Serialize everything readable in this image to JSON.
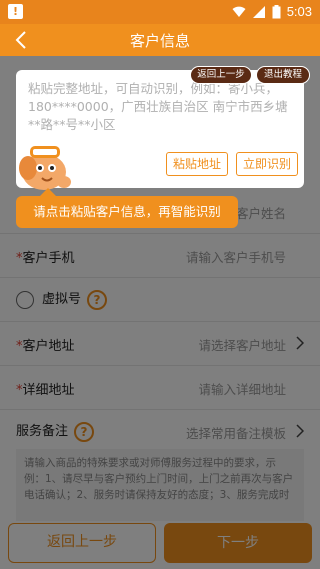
{
  "status_bar": {
    "time": "5:03",
    "warning_icon": "warning-icon"
  },
  "nav": {
    "title": "客户信息"
  },
  "tutorial": {
    "prev_label": "返回上一步",
    "exit_label": "退出教程",
    "tooltip": "请点击粘贴客户信息，再智能识别"
  },
  "paste_card": {
    "placeholder": "粘贴完整地址，可自动识别，例如：寄小兵，180****0000，广西壮族自治区 南宁市西乡塘**路**号**小区",
    "paste_label": "粘贴地址",
    "recognize_label": "立即识别"
  },
  "form": {
    "name_placeholder": "入客户姓名",
    "phone_label": "客户手机",
    "phone_placeholder": "请输入客户手机号",
    "virtual_label": "虚拟号",
    "address_label": "客户地址",
    "address_placeholder": "请选择客户地址",
    "detail_label": "详细地址",
    "detail_placeholder": "请输入详细地址",
    "remark_label": "服务备注",
    "remark_placeholder": "选择常用备注模板",
    "remark_text": "请输入商品的特殊要求或对师傅服务过程中的要求，示例：1、请尽早与客户预约上门时间，上门之前再次与客户电话确认；2、服务时请保持友好的态度；3、服务完成时"
  },
  "mascot_text": "",
  "bottom": {
    "back_label": "返回上一步",
    "next_label": "下一步"
  },
  "colors": {
    "accent": "#f0901e",
    "statusbar": "#e8841c",
    "required": "#e23b2e"
  }
}
